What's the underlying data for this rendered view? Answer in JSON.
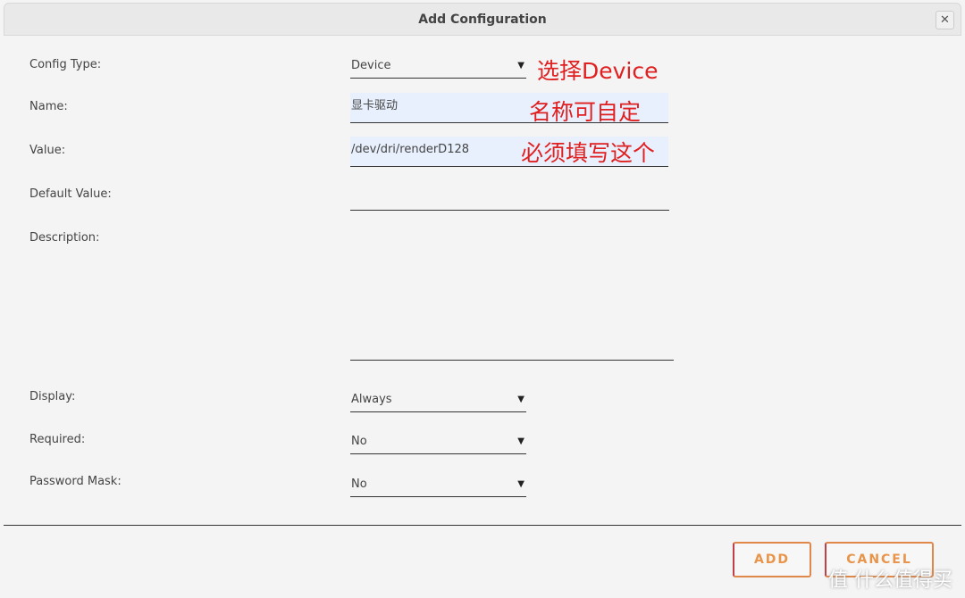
{
  "dialog": {
    "title": "Add Configuration",
    "close_icon": "close-icon"
  },
  "fields": {
    "config_type": {
      "label": "Config Type:",
      "value": "Device"
    },
    "name": {
      "label": "Name:",
      "value": "显卡驱动"
    },
    "value": {
      "label": "Value:",
      "value": "/dev/dri/renderD128"
    },
    "default_value": {
      "label": "Default Value:",
      "value": ""
    },
    "description": {
      "label": "Description:",
      "value": ""
    },
    "display": {
      "label": "Display:",
      "value": "Always"
    },
    "required": {
      "label": "Required:",
      "value": "No"
    },
    "password_mask": {
      "label": "Password Mask:",
      "value": "No"
    }
  },
  "annotations": {
    "config_type": "选择Device",
    "name": "名称可自定",
    "value": "必须填写这个",
    "color": "#e02020"
  },
  "buttons": {
    "add": "ADD",
    "cancel": "CANCEL"
  },
  "watermark": "值 什么值得买"
}
